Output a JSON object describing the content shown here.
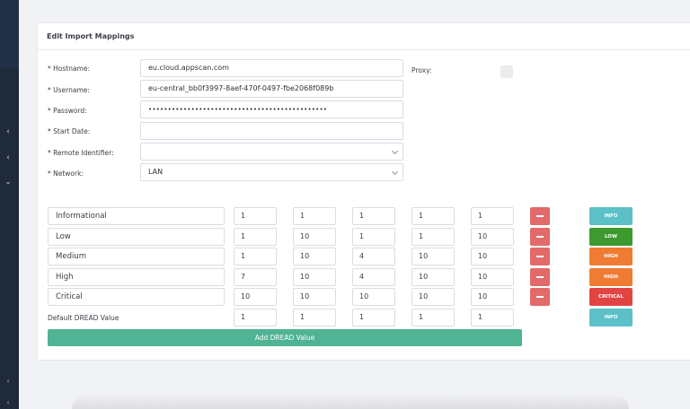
{
  "card": {
    "title": "Edit Import Mappings"
  },
  "form": {
    "hostname_label": "* Hostname:",
    "hostname_value": "eu.cloud.appscan.com",
    "username_label": "* Username:",
    "username_value": "eu-central_bb0f3997-8aef-470f-0497-fbe2068f089b",
    "password_label": "* Password:",
    "password_value": "••••••••••••••••••••••••••••••••••••••••••••••",
    "start_date_label": "* Start Date:",
    "start_date_value": "",
    "remote_identifier_label": "* Remote Identifier:",
    "remote_identifier_value": "",
    "network_label": "* Network:",
    "network_value": "LAN",
    "proxy_label": "Proxy:"
  },
  "dread": {
    "rows": [
      {
        "name": "Informational",
        "values": [
          "1",
          "1",
          "1",
          "1",
          "1"
        ],
        "severity": "INFO",
        "color": "#5bc0c8"
      },
      {
        "name": "Low",
        "values": [
          "1",
          "10",
          "1",
          "1",
          "10"
        ],
        "severity": "LOW",
        "color": "#3c9a2e"
      },
      {
        "name": "Medium",
        "values": [
          "1",
          "10",
          "4",
          "10",
          "10"
        ],
        "severity": "HIGH",
        "color": "#f07b32"
      },
      {
        "name": "High",
        "values": [
          "7",
          "10",
          "4",
          "10",
          "10"
        ],
        "severity": "HIGH",
        "color": "#f07b32"
      },
      {
        "name": "Critical",
        "values": [
          "10",
          "10",
          "10",
          "10",
          "10"
        ],
        "severity": "CRITICAL",
        "color": "#e24444"
      }
    ],
    "default_label": "Default DREAD Value",
    "default_values": [
      "1",
      "1",
      "1",
      "1",
      "1"
    ],
    "default_severity": "INFO",
    "add_label": "Add DREAD Value"
  },
  "icons": {
    "sidebar": [
      "chevron-left-icon",
      "chevron-left-icon",
      "chevron-down-icon"
    ],
    "remove": "minus-icon"
  }
}
